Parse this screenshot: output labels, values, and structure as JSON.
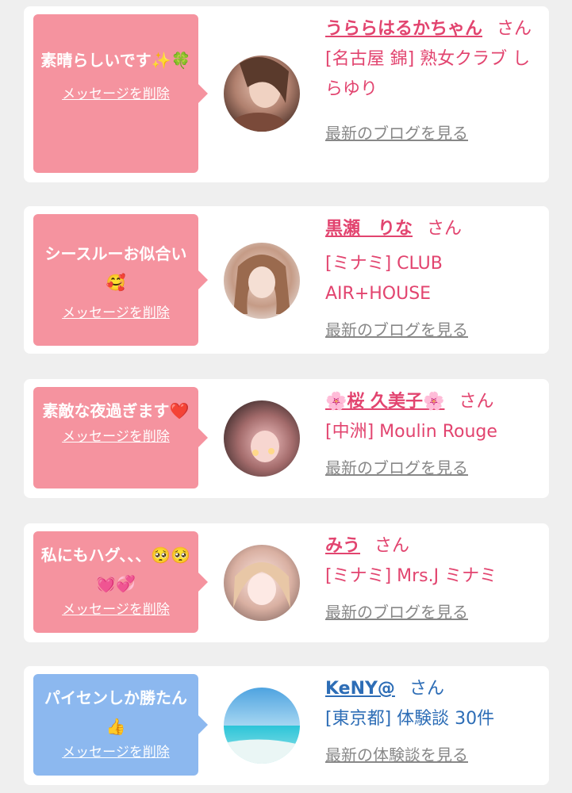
{
  "colors": {
    "page_bg": "#efefef",
    "card_bg": "#ffffff",
    "bubble_pink": "#f5939f",
    "bubble_blue": "#8cb8ef",
    "name_pink": "#e2446f",
    "name_blue": "#2d6db6",
    "link_gray": "#888888"
  },
  "items": [
    {
      "message": "素晴らしいです✨🍀",
      "delete_label": "メッセージを削除",
      "name": "うららはるかちゃん",
      "honorific": "さん",
      "shop": "[名古屋 錦] 熟女クラブ しらゆり",
      "link": "最新のブログを見る",
      "avatar": "avatar-photo-1"
    },
    {
      "message": "シースルーお似合い🥰",
      "delete_label": "メッセージを削除",
      "name": "黒瀬　りな",
      "honorific": "さん",
      "shop": "[ミナミ] CLUB AIR+HOUSE",
      "link": "最新のブログを見る",
      "avatar": "avatar-photo-2"
    },
    {
      "message": "素敵な夜過ぎます❤️",
      "delete_label": "メッセージを削除",
      "name": "🌸桜 久美子🌸",
      "honorific": "さん",
      "shop": "[中洲] Moulin Rouge",
      "link": "最新のブログを見る",
      "avatar": "avatar-photo-3"
    },
    {
      "message": "私にもハグ、、、🥺🥺💓💞",
      "delete_label": "メッセージを削除",
      "name": "みう",
      "honorific": "さん",
      "shop": "[ミナミ] Mrs.J ミナミ",
      "link": "最新のブログを見る",
      "avatar": "avatar-photo-4"
    },
    {
      "message": "パイセンしか勝たん👍",
      "delete_label": "メッセージを削除",
      "name": "KeNY@",
      "honorific": "さん",
      "shop": "[東京都] 体験談 30件",
      "link": "最新の体験談を見る",
      "avatar": "avatar-beach"
    }
  ]
}
